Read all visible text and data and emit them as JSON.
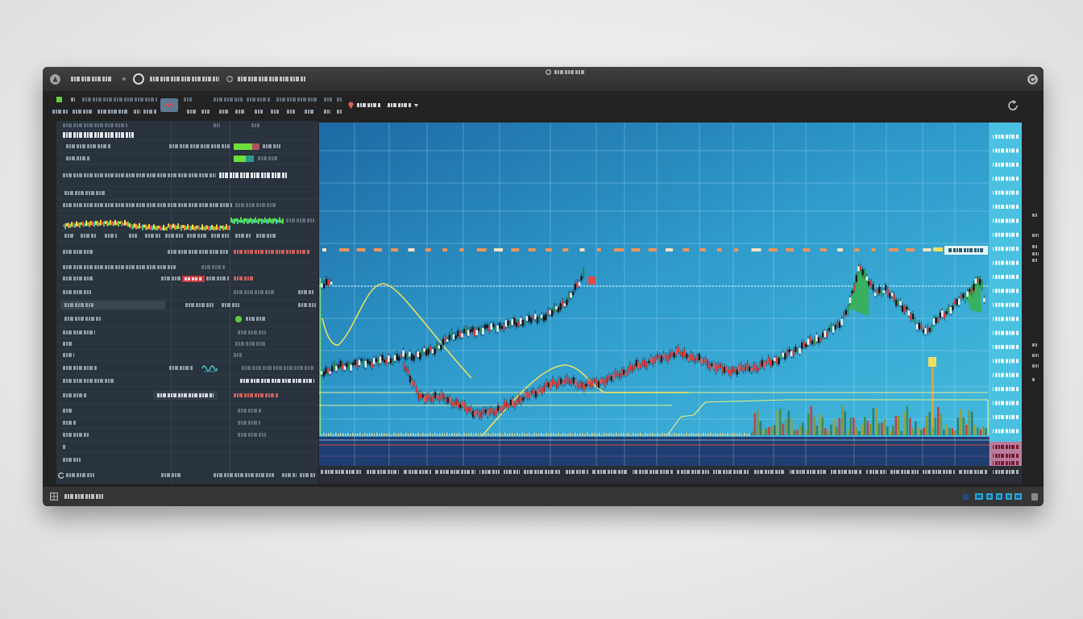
{
  "toolbar": {
    "tools": [
      {
        "selected": true
      },
      {
        "selected": false
      }
    ]
  },
  "side_panel": {
    "meters": [
      {
        "level": 0.72
      },
      {
        "level": 0.6
      }
    ]
  }
}
